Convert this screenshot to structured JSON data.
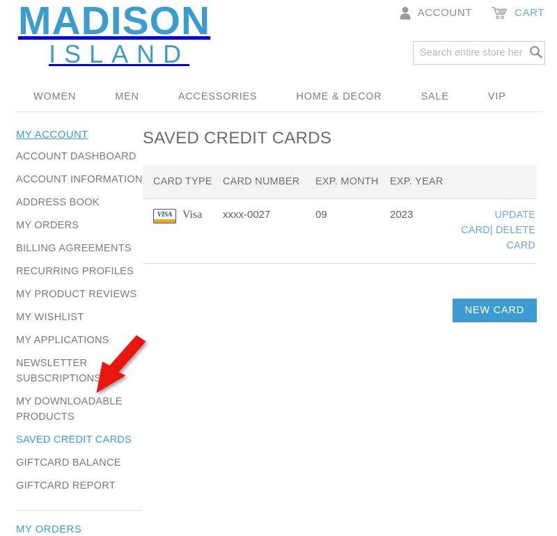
{
  "header": {
    "logo_main": "MADISON",
    "logo_sub": "ISLAND",
    "account_label": "ACCOUNT",
    "cart_label": "CART",
    "account_icon": "person-icon",
    "cart_icon": "cart-icon",
    "search": {
      "placeholder": "Search entire store here...",
      "value": "",
      "icon": "search-icon"
    }
  },
  "nav": {
    "items": [
      {
        "label": "WOMEN"
      },
      {
        "label": "MEN"
      },
      {
        "label": "ACCESSORIES"
      },
      {
        "label": "HOME & DECOR"
      },
      {
        "label": "SALE"
      },
      {
        "label": "VIP"
      }
    ]
  },
  "sidebar": {
    "title": "MY ACCOUNT",
    "items": [
      {
        "label": "ACCOUNT DASHBOARD",
        "active": false
      },
      {
        "label": "ACCOUNT INFORMATION",
        "active": false
      },
      {
        "label": "ADDRESS BOOK",
        "active": false
      },
      {
        "label": "MY ORDERS",
        "active": false
      },
      {
        "label": "BILLING AGREEMENTS",
        "active": false
      },
      {
        "label": "RECURRING PROFILES",
        "active": false
      },
      {
        "label": "MY PRODUCT REVIEWS",
        "active": false
      },
      {
        "label": "MY WISHLIST",
        "active": false
      },
      {
        "label": "MY APPLICATIONS",
        "active": false
      },
      {
        "label": "NEWSLETTER SUBSCRIPTIONS",
        "active": false
      },
      {
        "label": "MY DOWNLOADABLE PRODUCTS",
        "active": false
      },
      {
        "label": "SAVED CREDIT CARDS",
        "active": true
      },
      {
        "label": "GIFTCARD BALANCE",
        "active": false
      },
      {
        "label": "GIFTCARD REPORT",
        "active": false
      }
    ],
    "footer_link": "MY ORDERS"
  },
  "main": {
    "title": "SAVED CREDIT CARDS",
    "table": {
      "columns": [
        "CARD TYPE",
        "CARD NUMBER",
        "EXP. MONTH",
        "EXP. YEAR",
        ""
      ],
      "rows": [
        {
          "card_type": "Visa",
          "card_brand_icon": "visa-card-icon",
          "card_brand_text": "VISA",
          "card_number": "xxxx-0027",
          "exp_month": "09",
          "exp_year": "2023",
          "update_label": "UPDATE CARD",
          "separator": "|",
          "delete_label": "DELETE CARD"
        }
      ]
    },
    "new_card_label": "NEW CARD"
  },
  "annotation": {
    "type": "arrow",
    "color": "#e8140c",
    "points_to": "SAVED CREDIT CARDS"
  },
  "colors": {
    "brand_blue": "#3c9cd0",
    "link_blue": "#6aa9dc",
    "text_gray": "#6f6f6f",
    "annotation_red": "#e8140c",
    "visa_gold": "#f3a81c",
    "visa_blue": "#1a4f9c"
  }
}
